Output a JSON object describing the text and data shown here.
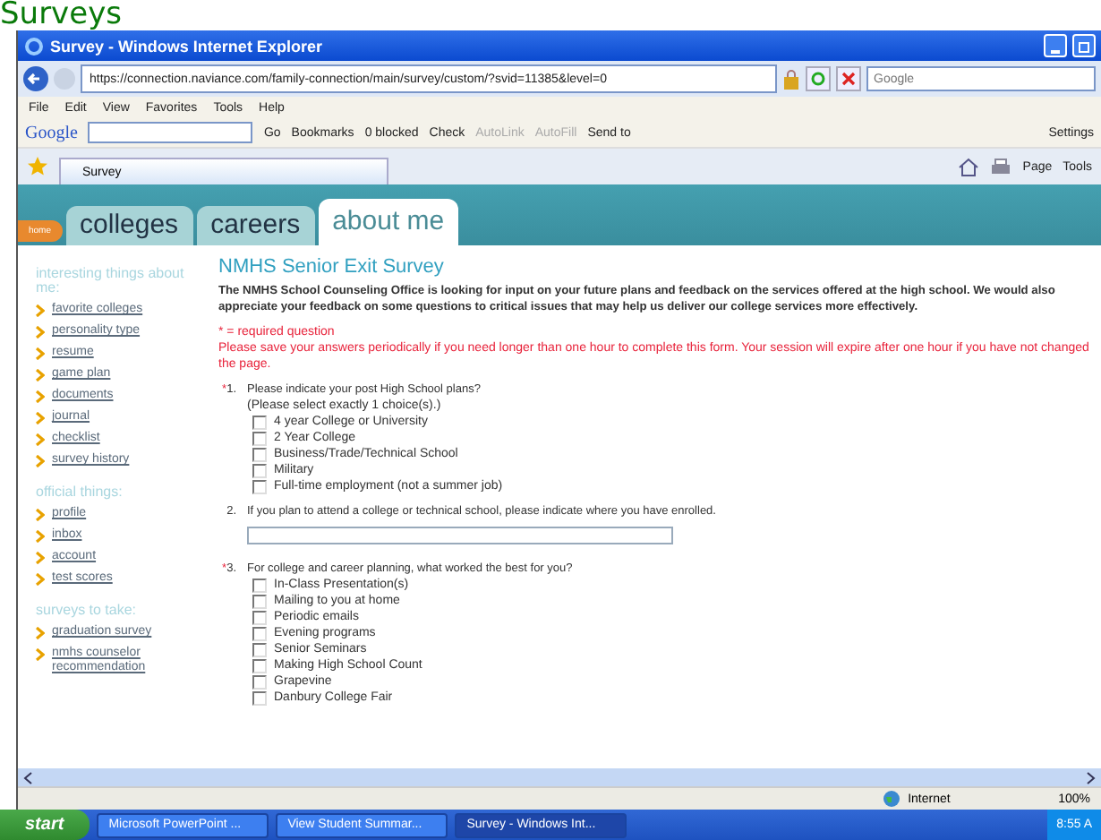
{
  "banner": {
    "text": "Surveys"
  },
  "window": {
    "title": "Survey - Windows Internet Explorer"
  },
  "address_bar": {
    "url": "https://connection.naviance.com/family-connection/main/survey/custom/?svid=11385&level=0",
    "search_placeholder": "Google"
  },
  "menu": [
    "File",
    "Edit",
    "View",
    "Favorites",
    "Tools",
    "Help"
  ],
  "google_toolbar": {
    "logo": "Google",
    "go": "Go",
    "items": [
      {
        "label": "Bookmarks",
        "disabled": false
      },
      {
        "label": "0 blocked",
        "disabled": false
      },
      {
        "label": "Check",
        "disabled": false
      },
      {
        "label": "AutoLink",
        "disabled": true
      },
      {
        "label": "AutoFill",
        "disabled": true
      },
      {
        "label": "Send to",
        "disabled": false
      }
    ],
    "settings": "Settings"
  },
  "browser_tab": {
    "label": "Survey"
  },
  "command_bar": [
    "Page",
    "Tools"
  ],
  "site": {
    "home": "home",
    "tabs": [
      {
        "label": "colleges",
        "selected": false
      },
      {
        "label": "careers",
        "selected": false
      },
      {
        "label": "about me",
        "selected": true
      }
    ]
  },
  "sidebar": [
    {
      "heading": "interesting things about me:",
      "links": [
        "favorite colleges",
        "personality type",
        "resume",
        "game plan",
        "documents",
        "journal",
        "checklist",
        "survey history"
      ]
    },
    {
      "heading": "official things:",
      "links": [
        "profile",
        "inbox",
        "account",
        "test scores"
      ]
    },
    {
      "heading": "surveys to take:",
      "links": [
        "graduation survey",
        "nmhs counselor recommendation"
      ]
    }
  ],
  "survey": {
    "title": "NMHS Senior Exit Survey",
    "intro": "The NMHS School Counseling Office is looking for input on your future plans and feedback on the services offered at the high school. We would also appreciate your feedback on some questions to critical issues that may help us deliver our college services more effectively.",
    "required_note": "* = required question",
    "warning": "Please save your answers periodically if you need longer than one hour to complete this form. Your session will expire after one hour if you have not changed the page.",
    "questions": [
      {
        "kind": "checkboxes",
        "required_mark": "*",
        "number": "1.",
        "text": "Please indicate your post High School plans?",
        "hint": "(Please select exactly 1 choice(s).)",
        "options": [
          {
            "label": "4 year College or University",
            "checked": false
          },
          {
            "label": "2 Year College",
            "checked": false
          },
          {
            "label": "Business/Trade/Technical School",
            "checked": false
          },
          {
            "label": "Military",
            "checked": false
          },
          {
            "label": "Full-time employment (not a summer job)",
            "checked": false
          }
        ]
      },
      {
        "kind": "text",
        "number": "2.",
        "text": "If you plan to attend a college or technical school, please indicate where you have enrolled."
      },
      {
        "kind": "checkboxes",
        "required_mark": "*",
        "number": "3.",
        "text": "For college and career planning, what worked the best for you?",
        "options": [
          {
            "label": "In-Class Presentation(s)",
            "checked": false
          },
          {
            "label": "Mailing to you at home",
            "checked": false
          },
          {
            "label": "Periodic emails",
            "checked": false
          },
          {
            "label": "Evening programs",
            "checked": false
          },
          {
            "label": "Senior Seminars",
            "checked": false
          },
          {
            "label": "Making High School Count",
            "checked": false
          },
          {
            "label": "Grapevine",
            "checked": false
          },
          {
            "label": "Danbury College Fair",
            "checked": false
          }
        ]
      }
    ]
  },
  "status_bar": {
    "zone": "Internet",
    "zoom": "100%"
  },
  "taskbar": {
    "start": "start",
    "tasks": [
      {
        "label": "Microsoft PowerPoint ...",
        "selected": false
      },
      {
        "label": "View Student Summar...",
        "selected": false
      },
      {
        "label": "Survey - Windows Int...",
        "selected": true
      }
    ],
    "clock": "8:55 A"
  }
}
